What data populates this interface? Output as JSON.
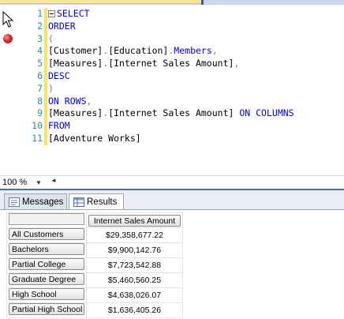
{
  "editor": {
    "line_numbers": [
      "1",
      "2",
      "3",
      "4",
      "5",
      "6",
      "7",
      "8",
      "9",
      "10",
      "11"
    ],
    "lines": [
      {
        "parts": [
          {
            "t": "SELECT",
            "c": "kw"
          }
        ]
      },
      {
        "parts": [
          {
            "t": "ORDER",
            "c": "kw"
          }
        ]
      },
      {
        "parts": [
          {
            "t": "(",
            "c": "gr"
          }
        ]
      },
      {
        "parts": [
          {
            "t": "[Customer]",
            "c": "pl"
          },
          {
            "t": ".",
            "c": "gr"
          },
          {
            "t": "[Education]",
            "c": "pl"
          },
          {
            "t": ".",
            "c": "gr"
          },
          {
            "t": "Members",
            "c": "kw"
          },
          {
            "t": ",",
            "c": "gr"
          }
        ]
      },
      {
        "parts": [
          {
            "t": "[Measures]",
            "c": "pl"
          },
          {
            "t": ".",
            "c": "gr"
          },
          {
            "t": "[Internet Sales Amount]",
            "c": "pl"
          },
          {
            "t": ",",
            "c": "gr"
          }
        ]
      },
      {
        "parts": [
          {
            "t": "DESC",
            "c": "kw"
          }
        ]
      },
      {
        "parts": [
          {
            "t": ")",
            "c": "gr"
          }
        ]
      },
      {
        "parts": [
          {
            "t": "ON ROWS",
            "c": "kw"
          },
          {
            "t": ",",
            "c": "gr"
          }
        ]
      },
      {
        "parts": [
          {
            "t": "[Measures]",
            "c": "pl"
          },
          {
            "t": ".",
            "c": "gr"
          },
          {
            "t": "[Internet Sales Amount]",
            "c": "pl"
          },
          {
            "t": " ON COLUMNS",
            "c": "kw"
          }
        ]
      },
      {
        "parts": [
          {
            "t": "FROM",
            "c": "kw"
          }
        ]
      },
      {
        "parts": [
          {
            "t": "[Adventure Works]",
            "c": "pl"
          }
        ]
      }
    ]
  },
  "zoom": {
    "value": "100 %"
  },
  "results_tabs": {
    "messages": "Messages",
    "results": "Results"
  },
  "grid": {
    "column_header": "Internet Sales Amount",
    "rows": [
      {
        "label": "All Customers",
        "value": "$29,358,677.22"
      },
      {
        "label": "Bachelors",
        "value": "$9,900,142.76"
      },
      {
        "label": "Partial College",
        "value": "$7,723,542.88"
      },
      {
        "label": "Graduate Degree",
        "value": "$5,460,560.25"
      },
      {
        "label": "High School",
        "value": "$4,638,026.07"
      },
      {
        "label": "Partial High School",
        "value": "$1,636,405.26"
      }
    ]
  },
  "colors": {
    "keyword": "#0000ff",
    "punctuation": "#808080",
    "line_number": "#2b91af",
    "breakpoint": "#d72b2b"
  }
}
